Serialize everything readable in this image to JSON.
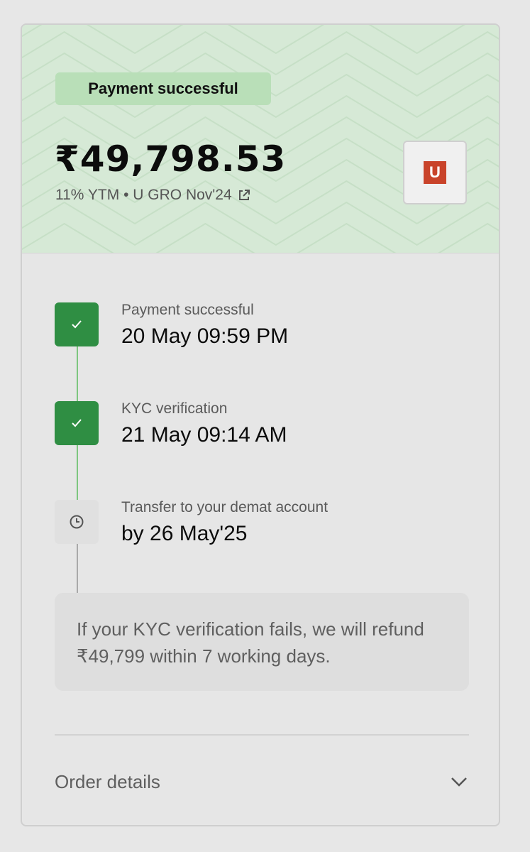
{
  "header": {
    "status_pill": "Payment successful",
    "amount": "₹49,798.53",
    "subline": "11% YTM • U GRO Nov'24",
    "logo_letter": "U",
    "colors": {
      "hero_bg": "#d6e9d6",
      "pill_bg": "#b9dfb8",
      "logo_bg": "#c9432a"
    }
  },
  "timeline": {
    "steps": [
      {
        "label": "Payment successful",
        "value": "20 May 09:59 PM",
        "state": "done",
        "icon": "check-icon"
      },
      {
        "label": "KYC verification",
        "value": "21 May 09:14 AM",
        "state": "done",
        "icon": "check-icon"
      },
      {
        "label": "Transfer to your demat account",
        "value": "by 26 May'25",
        "state": "pending",
        "icon": "clock-icon"
      }
    ],
    "colors": {
      "done": "#2f8e43",
      "pending": "#e0e0e0",
      "line_done": "#7dc67f",
      "line_pending": "#a9a9a9"
    }
  },
  "notice": {
    "text": "If your KYC verification fails, we will refund ₹49,799 within 7 working days."
  },
  "order": {
    "label": "Order details",
    "icon": "chevron-down-icon"
  }
}
